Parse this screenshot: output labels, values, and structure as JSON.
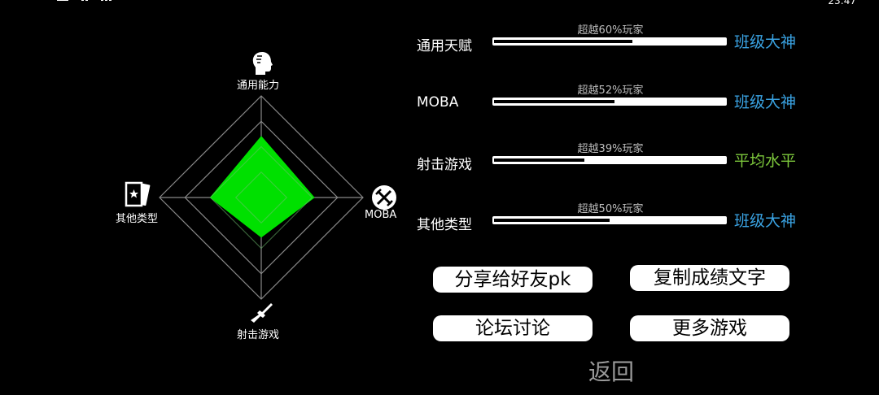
{
  "status_bar": {
    "time": "23:47"
  },
  "radar": {
    "axes": [
      {
        "label": "通用能力",
        "icon": "head-profile-icon"
      },
      {
        "label": "MOBA",
        "icon": "crossed-swords-icon"
      },
      {
        "label": "射击游戏",
        "icon": "rifle-icon"
      },
      {
        "label": "其他类型",
        "icon": "playing-card-icon"
      }
    ],
    "values": [
      0.6,
      0.52,
      0.39,
      0.5
    ],
    "fill_color": "#00e000",
    "grid_color": "#888888"
  },
  "stats": [
    {
      "name": "通用天赋",
      "percent_text": "超越60%玩家",
      "percent": 60,
      "rank": "班级大神",
      "rank_color": "#3aa3e3"
    },
    {
      "name": "MOBA",
      "percent_text": "超越52%玩家",
      "percent": 52,
      "rank": "班级大神",
      "rank_color": "#3aa3e3"
    },
    {
      "name": "射击游戏",
      "percent_text": "超越39%玩家",
      "percent": 39,
      "rank": "平均水平",
      "rank_color": "#7dc83c"
    },
    {
      "name": "其他类型",
      "percent_text": "超越50%玩家",
      "percent": 50,
      "rank": "班级大神",
      "rank_color": "#3aa3e3"
    }
  ],
  "buttons": {
    "share": "分享给好友pk",
    "copy": "复制成绩文字",
    "forum": "论坛讨论",
    "more": "更多游戏"
  },
  "back_label": "返回"
}
